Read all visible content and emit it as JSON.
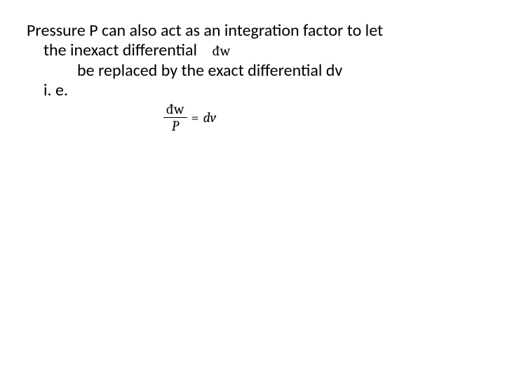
{
  "body": {
    "line1": "Pressure P can also act as an integration factor to let",
    "line2_prefix": "the inexact differential",
    "inline_inexact": "đw",
    "line3": "be replaced by the exact differential dv",
    "line4": "i. e."
  },
  "equation": {
    "numerator": "đw",
    "denominator": "P",
    "equals": "=",
    "rhs": "dv"
  }
}
